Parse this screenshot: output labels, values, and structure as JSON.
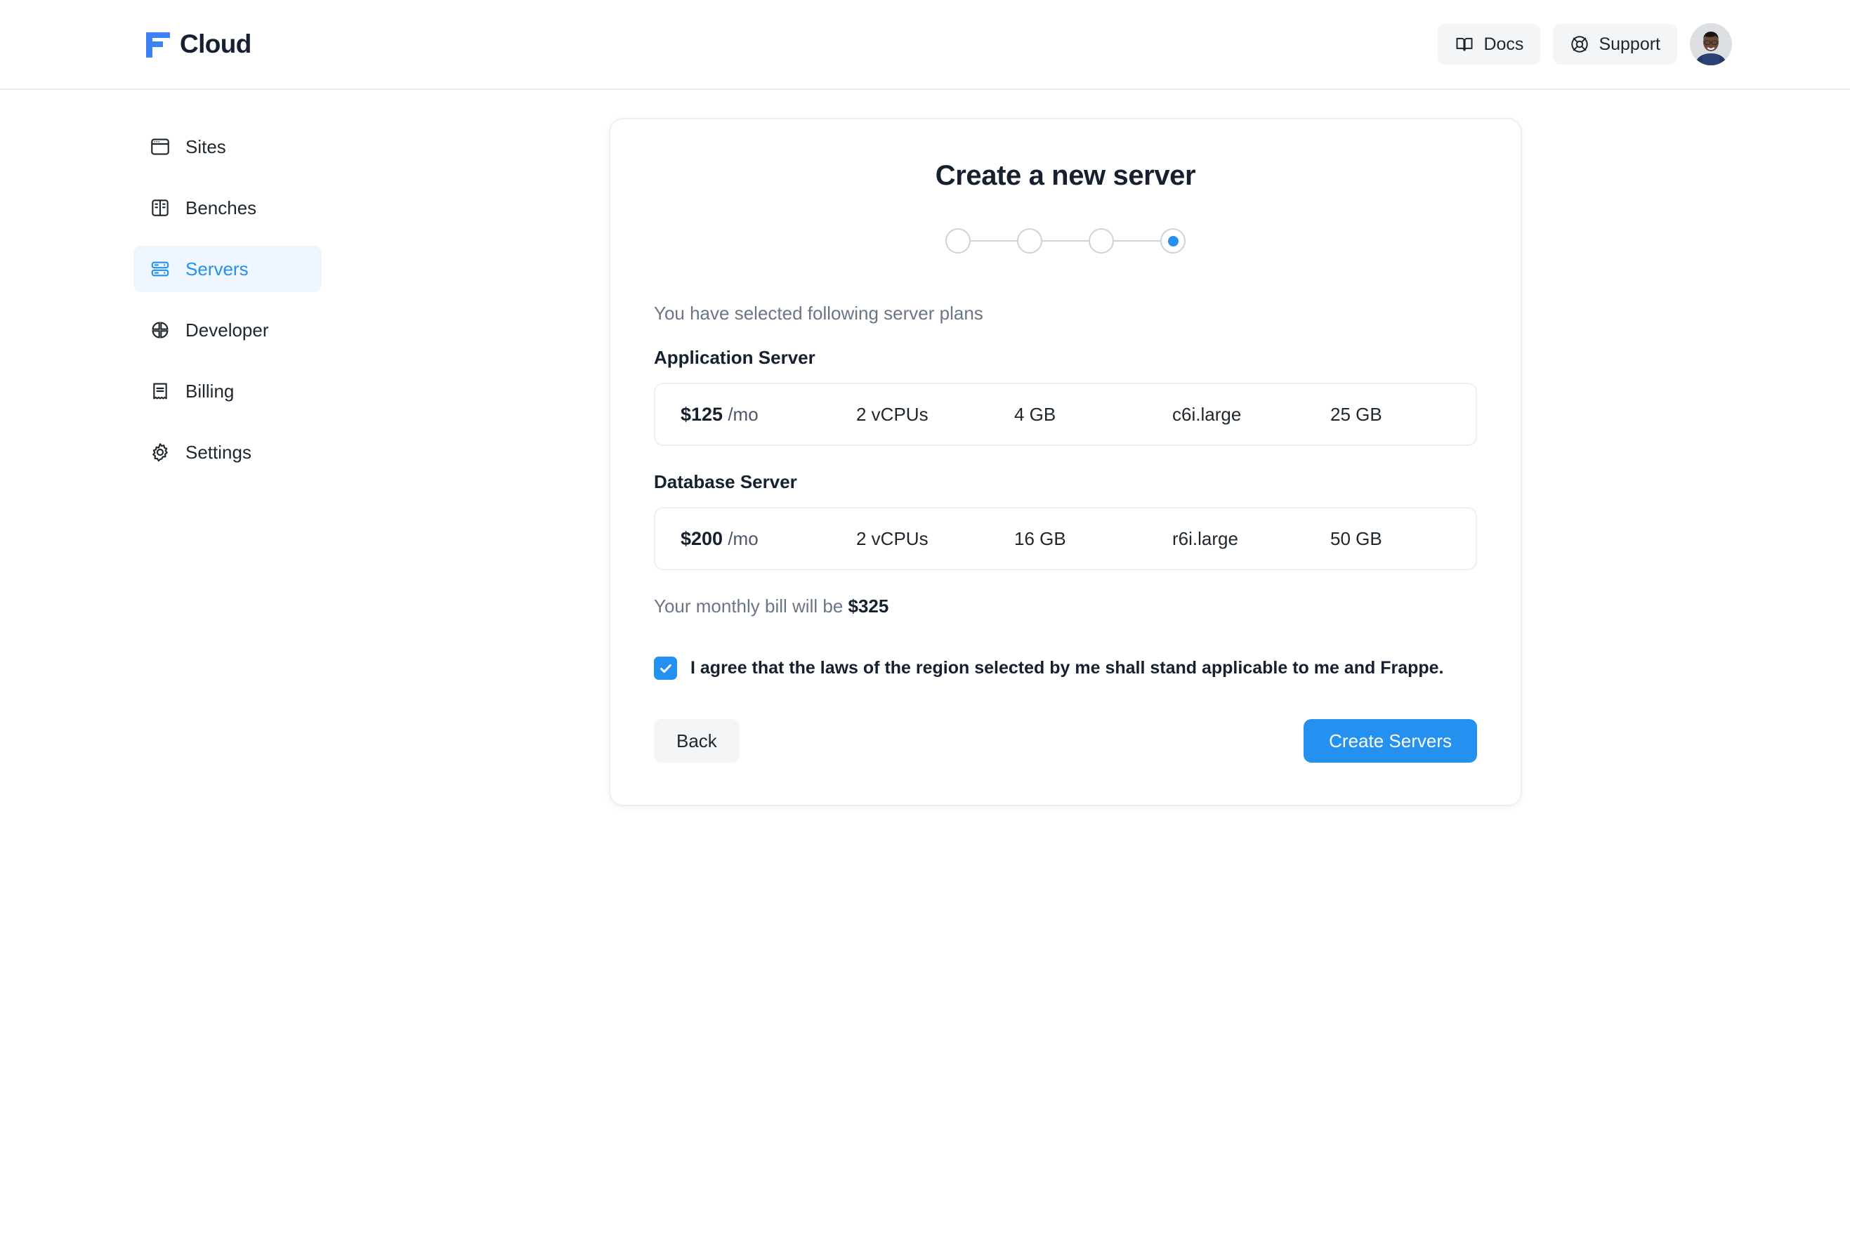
{
  "header": {
    "brand": "Cloud",
    "brand_icon": "frappe-f-logo",
    "docs_label": "Docs",
    "docs_icon": "book-icon",
    "support_label": "Support",
    "support_icon": "lifebuoy-icon",
    "avatar_icon": "user-avatar"
  },
  "sidebar": {
    "items": [
      {
        "label": "Sites",
        "icon": "browser-window-icon",
        "active": false
      },
      {
        "label": "Benches",
        "icon": "panels-icon",
        "active": false
      },
      {
        "label": "Servers",
        "icon": "server-rack-icon",
        "active": true
      },
      {
        "label": "Developer",
        "icon": "quadrants-icon",
        "active": false
      },
      {
        "label": "Billing",
        "icon": "receipt-icon",
        "active": false
      },
      {
        "label": "Settings",
        "icon": "gear-icon",
        "active": false
      }
    ]
  },
  "card": {
    "title": "Create a new server",
    "stepper": {
      "total": 4,
      "current": 4
    },
    "lead": "You have selected following server plans",
    "sections": [
      {
        "title": "Application Server",
        "plan": {
          "price": "$125",
          "per": "/mo",
          "vcpu": "2 vCPUs",
          "memory": "4 GB",
          "instance": "c6i.large",
          "disk": "25 GB"
        }
      },
      {
        "title": "Database Server",
        "plan": {
          "price": "$200",
          "per": "/mo",
          "vcpu": "2 vCPUs",
          "memory": "16 GB",
          "instance": "r6i.large",
          "disk": "50 GB"
        }
      }
    ],
    "bill_prefix": "Your monthly bill will be ",
    "bill_total": "$325",
    "agreement": {
      "checked": true,
      "label": "I agree that the laws of the region selected by me shall stand applicable to me and Frappe."
    },
    "back_label": "Back",
    "create_label": "Create Servers"
  },
  "colors": {
    "accent": "#2490EF",
    "brand_mark": "#3B82F6",
    "text": "#16202E",
    "muted": "#6B7684",
    "border": "#EDEFF2",
    "active_bg": "#EFF6FF",
    "soft_bg": "#F4F5F6"
  }
}
